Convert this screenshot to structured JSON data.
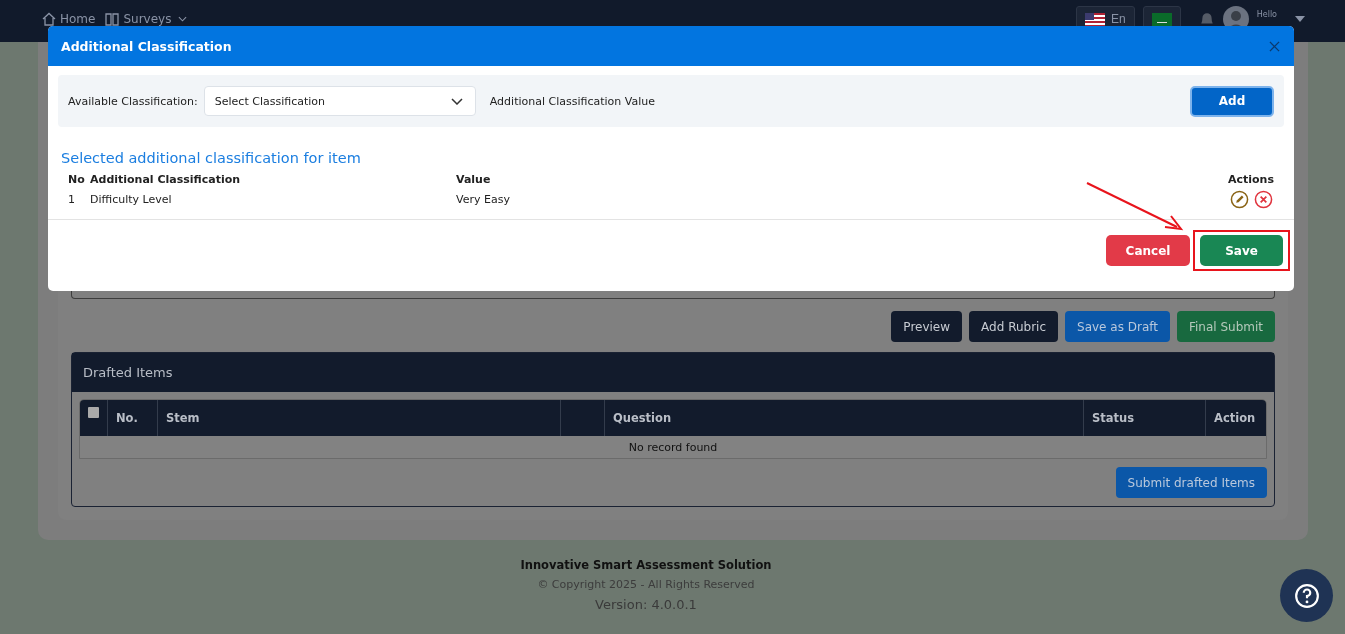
{
  "nav": {
    "items": [
      {
        "label": "Home",
        "kind": "home"
      },
      {
        "label": "Surveys",
        "kind": "surveys"
      }
    ],
    "language": "En",
    "greeting": "Hello"
  },
  "page": {
    "buttons": [
      {
        "label": "Preview",
        "kind": "dark"
      },
      {
        "label": "Add Rubric",
        "kind": "dark"
      },
      {
        "label": "Save as Draft",
        "kind": "blue"
      },
      {
        "label": "Final Submit",
        "kind": "green"
      }
    ],
    "drafted": {
      "title": "Drafted Items",
      "select_all": {
        "checked": false
      },
      "columns": [
        "No.",
        "Stem",
        "",
        "Question",
        "Status",
        "Action"
      ],
      "empty": "No record found",
      "submit": "Submit drafted Items"
    }
  },
  "footer": {
    "title": "Innovative Smart Assessment Solution",
    "copyright": "© Copyright 2025 - All Rights Reserved",
    "version": "Version: 4.0.0.1"
  },
  "modal": {
    "title": "Additional Classification",
    "available_label": "Available Classification:",
    "select_placeholder": "Select Classification",
    "value_label": "Additional Classification Value",
    "add": "Add",
    "section_title": "Selected additional classification for item",
    "columns": {
      "no": "No",
      "classification": "Additional Classification",
      "value": "Value",
      "actions": "Actions"
    },
    "rows": [
      {
        "no": "1",
        "classification": "Difficulty Level",
        "value": "Very Easy"
      }
    ],
    "cancel": "Cancel",
    "save": "Save"
  }
}
